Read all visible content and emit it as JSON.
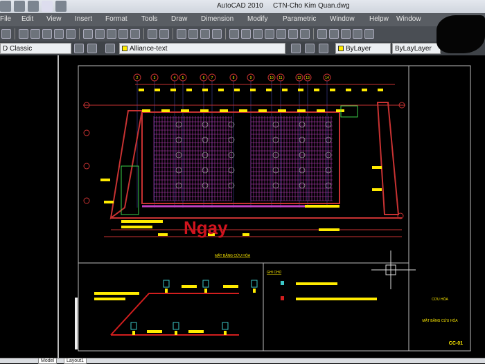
{
  "window": {
    "app": "AutoCAD 2010",
    "file": "CTN-Cho Kim Quan.dwg"
  },
  "menu": [
    "File",
    "Edit",
    "View",
    "Insert",
    "Format",
    "Tools",
    "Draw",
    "Dimension",
    "Modify",
    "Parametric",
    "Window",
    "Helpw",
    "Window"
  ],
  "toolbar2": {
    "workspace": "D Classic",
    "layer": "Alliance-text",
    "color": "ByLayer",
    "linetype": "ByLayLayer"
  },
  "drawing": {
    "grid_bubbles": [
      "2",
      "3",
      "4",
      "5",
      "6",
      "7",
      "8",
      "9",
      "10",
      "11",
      "12",
      "13",
      "14"
    ],
    "plan_title": "MẶT BẰNG CỨU HỎA",
    "legend_title": "GHI CHÚ",
    "titleblock": {
      "line1": "CỨU HỎA",
      "line2": "MẶT BẰNG CỨU HỎA",
      "sheet": "CC-01"
    },
    "watermark": "Ngay"
  },
  "status": {
    "tabs": [
      "Model",
      "Layout1"
    ]
  },
  "colors": {
    "background": "#000000",
    "frame": "#c83232",
    "bar": "#ffeb00",
    "hatch": "#c040c0"
  }
}
